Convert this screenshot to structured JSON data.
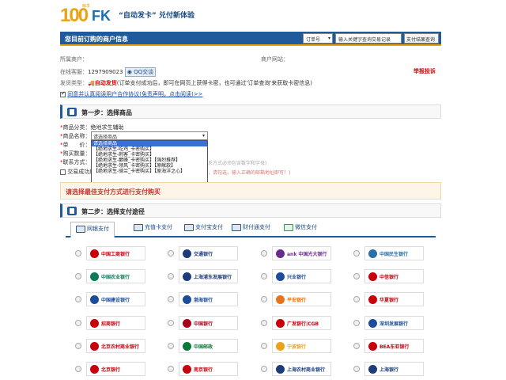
{
  "header": {
    "logo_number": "100",
    "logo_letters": "FK",
    "logo_small": "触发",
    "slogan": "“自动发卡” 兑付新体验"
  },
  "bar": {
    "title": "您目前订购的商户信息",
    "order_type": "订单号",
    "order_placeholder": "输入关键字查询交易记录",
    "search_button": "支付结果查询"
  },
  "merchant": {
    "owner_label": "所属商户：",
    "website_label": "商户网站：",
    "qq_label": "在线客服：",
    "qq_number": "1297909023",
    "qq_badge": "QQ交谈",
    "report_link": "举报投诉",
    "delivery_label": "发货类型：",
    "delivery_type": "自动发货",
    "delivery_desc": "(订单支付成功后，即可在网页上获得卡密，也可通过'订单查询'来获取卡密信息)",
    "agree_text": "同意并认真阅读用户合作协议(免责声明，点击阅读)>>"
  },
  "step1": {
    "title": "第一步：选择商品",
    "category_label": "商品分类：",
    "category_value": "绝地求生辅助",
    "name_label": "商品名称：",
    "name_selected": "请选择商品",
    "price_label": "单　　价：",
    "quantity_label": "购买数量：",
    "contact_label": "联系方式：",
    "sms_label": "交易成功后",
    "options": [
      "请选择商品",
      "【绝地求生-吃鸡_卡密购买】",
      "【绝地求生-刺客_卡密购买】",
      "【绝地求生-巅峰_卡密购买】【强烈推荐】",
      "【绝地求生-领风_卡密购买】【原献款】",
      "【绝地求生-骑兰_卡密购买】【原海洋之心】"
    ],
    "behind_contact": "系方式必须包含数字和字母)",
    "behind_sms": "，请勾选，输入正确的邮箱地址即可！)"
  },
  "payment_hint": "请选择最佳支付方式进行支付购买",
  "step2": {
    "title": "第二步：选择支付途径",
    "tabs": [
      "网银支付",
      "充值卡支付",
      "支付宝支付",
      "财付通支付",
      "微信支付"
    ]
  },
  "banks": [
    {
      "name": "中国工商银行",
      "color": "#c7000b"
    },
    {
      "name": "交通银行",
      "color": "#1d3d7a"
    },
    {
      "name": "ank 中国光大银行",
      "color": "#6a2c8c"
    },
    {
      "name": "中国民生银行",
      "color": "#2a6fa8"
    },
    {
      "name": "中国农业银行",
      "color": "#0a7a5a"
    },
    {
      "name": "上海浦东发展银行",
      "color": "#1d3d7a"
    },
    {
      "name": "兴业银行",
      "color": "#1d4d9a"
    },
    {
      "name": "中信银行",
      "color": "#c7000b"
    },
    {
      "name": "中国建设银行",
      "color": "#1d4d9a"
    },
    {
      "name": "渤海银行",
      "color": "#1d4d9a"
    },
    {
      "name": "平安银行",
      "color": "#e8731a"
    },
    {
      "name": "华夏银行",
      "color": "#c7000b"
    },
    {
      "name": "招商银行",
      "color": "#c7000b"
    },
    {
      "name": "中国银行",
      "color": "#a8001a"
    },
    {
      "name": "广发银行|CGB",
      "color": "#c7000b"
    },
    {
      "name": "深圳发展银行",
      "color": "#1d4d9a"
    },
    {
      "name": "北京农村商业银行",
      "color": "#c7000b"
    },
    {
      "name": "中国邮政",
      "color": "#0a7a3a"
    },
    {
      "name": "宁波银行",
      "color": "#e8a317"
    },
    {
      "name": "BEA东亚银行",
      "color": "#c7000b"
    },
    {
      "name": "北京银行",
      "color": "#c7000b"
    },
    {
      "name": "南京银行",
      "color": "#c7000b"
    },
    {
      "name": "上海农村商业银行",
      "color": "#1d3d7a"
    },
    {
      "name": "上海银行",
      "color": "#1d3d7a"
    }
  ]
}
